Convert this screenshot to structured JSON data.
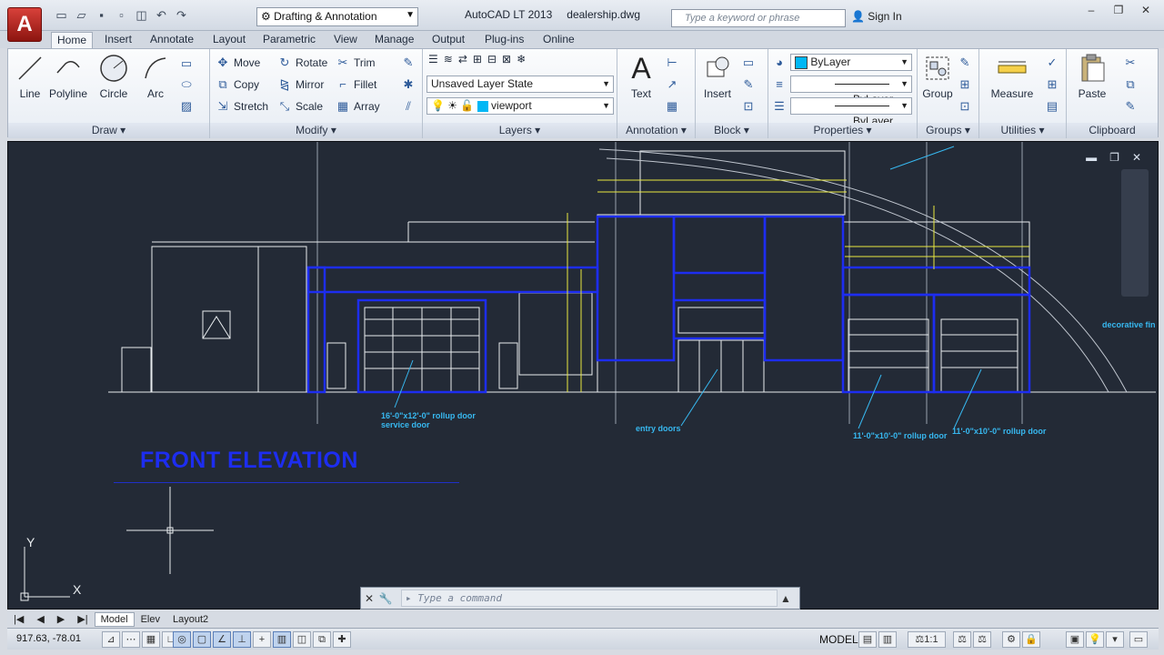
{
  "app": {
    "name": "AutoCAD LT 2013",
    "file": "dealership.dwg",
    "workspace": "Drafting & Annotation",
    "logo": "A"
  },
  "search": {
    "placeholder": "Type a keyword or phrase"
  },
  "user": {
    "signin": "Sign In"
  },
  "tabs": [
    "Home",
    "Insert",
    "Annotate",
    "Layout",
    "Parametric",
    "View",
    "Manage",
    "Output",
    "Plug-ins",
    "Online"
  ],
  "ribbon": {
    "draw": {
      "title": "Draw",
      "line": "Line",
      "polyline": "Polyline",
      "circle": "Circle",
      "arc": "Arc"
    },
    "modify": {
      "title": "Modify",
      "move": "Move",
      "rotate": "Rotate",
      "trim": "Trim",
      "copy": "Copy",
      "mirror": "Mirror",
      "fillet": "Fillet",
      "stretch": "Stretch",
      "scale": "Scale",
      "array": "Array"
    },
    "layers": {
      "title": "Layers",
      "state": "Unsaved Layer State",
      "current": "viewport"
    },
    "annotation": {
      "title": "Annotation",
      "text": "Text"
    },
    "block": {
      "title": "Block",
      "insert": "Insert"
    },
    "properties": {
      "title": "Properties",
      "color": "ByLayer",
      "linetype": "ByLayer",
      "lineweight": "ByLayer"
    },
    "groups": {
      "title": "Groups",
      "group": "Group"
    },
    "utilities": {
      "title": "Utilities",
      "measure": "Measure"
    },
    "clipboard": {
      "title": "Clipboard",
      "paste": "Paste"
    }
  },
  "drawing": {
    "title": "FRONT ELEVATION",
    "notes": {
      "service1": "16'-0\"x12'-0\" rollup door",
      "service2": "service door",
      "entry": "entry doors",
      "rollup1": "11'-0\"x10'-0\" rollup door",
      "rollup2": "11'-0\"x10'-0\" rollup door",
      "deco": "decorative fin"
    },
    "ucs": {
      "y": "Y",
      "x": "X"
    }
  },
  "command": {
    "placeholder": "Type a command"
  },
  "layouts": [
    "Model",
    "Elev",
    "Layout2"
  ],
  "status": {
    "coords": "917.63, -78.01",
    "space": "MODEL",
    "scale": "1:1"
  },
  "colors": {
    "accent": "#1d2df0",
    "canvas": "#232a36",
    "annotation": "#37b8f0"
  }
}
